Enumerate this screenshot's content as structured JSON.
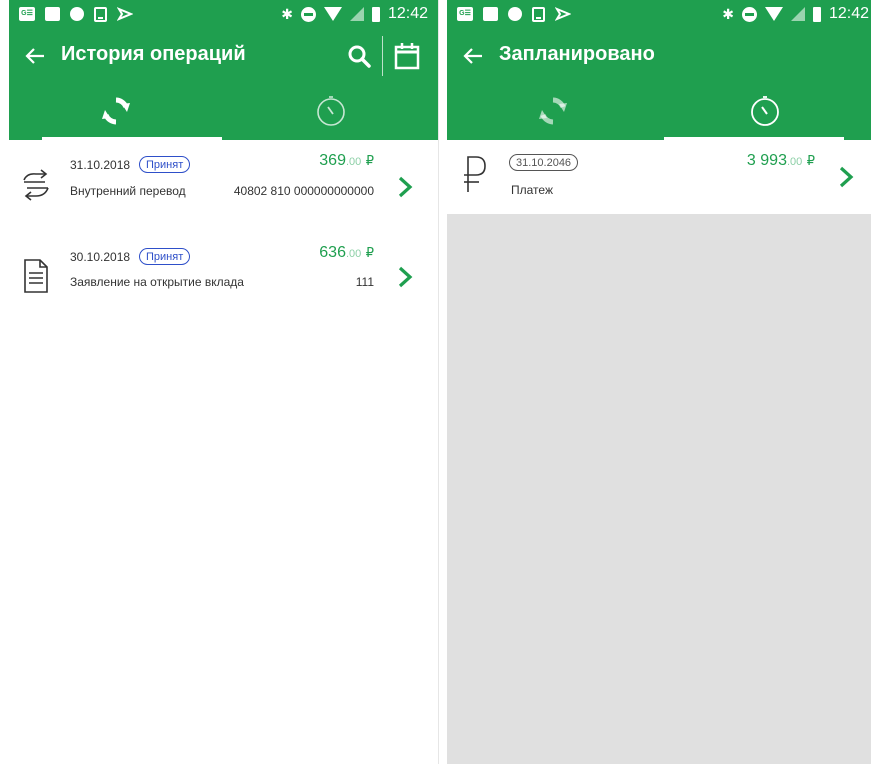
{
  "status_bar": {
    "time": "12:42",
    "gmail_label": "G☰"
  },
  "left": {
    "title": "История операций",
    "operations": [
      {
        "date": "31.10.2018",
        "status": "Принят",
        "amount_int": "369",
        "amount_frac": ".00",
        "currency": "₽",
        "description": "Внутренний перевод",
        "detail": "40802 810 000000000000",
        "icon": "exchange-arrows-icon"
      },
      {
        "date": "30.10.2018",
        "status": "Принят",
        "amount_int": "636",
        "amount_frac": ".00",
        "currency": "₽",
        "description": "Заявление на открытие вклада",
        "detail": "111",
        "icon": "document-icon"
      }
    ],
    "active_tab": "history"
  },
  "right": {
    "title": "Запланировано",
    "payments": [
      {
        "date": "31.10.2046",
        "amount_int": "3 993",
        "amount_frac": ".00",
        "currency": "₽",
        "description": "Платеж",
        "icon": "ruble-icon"
      }
    ],
    "active_tab": "scheduled"
  },
  "colors": {
    "brand_green": "#1f9f4f",
    "status_blue": "#2e4fc9",
    "background_gray": "#e0e0e0"
  }
}
